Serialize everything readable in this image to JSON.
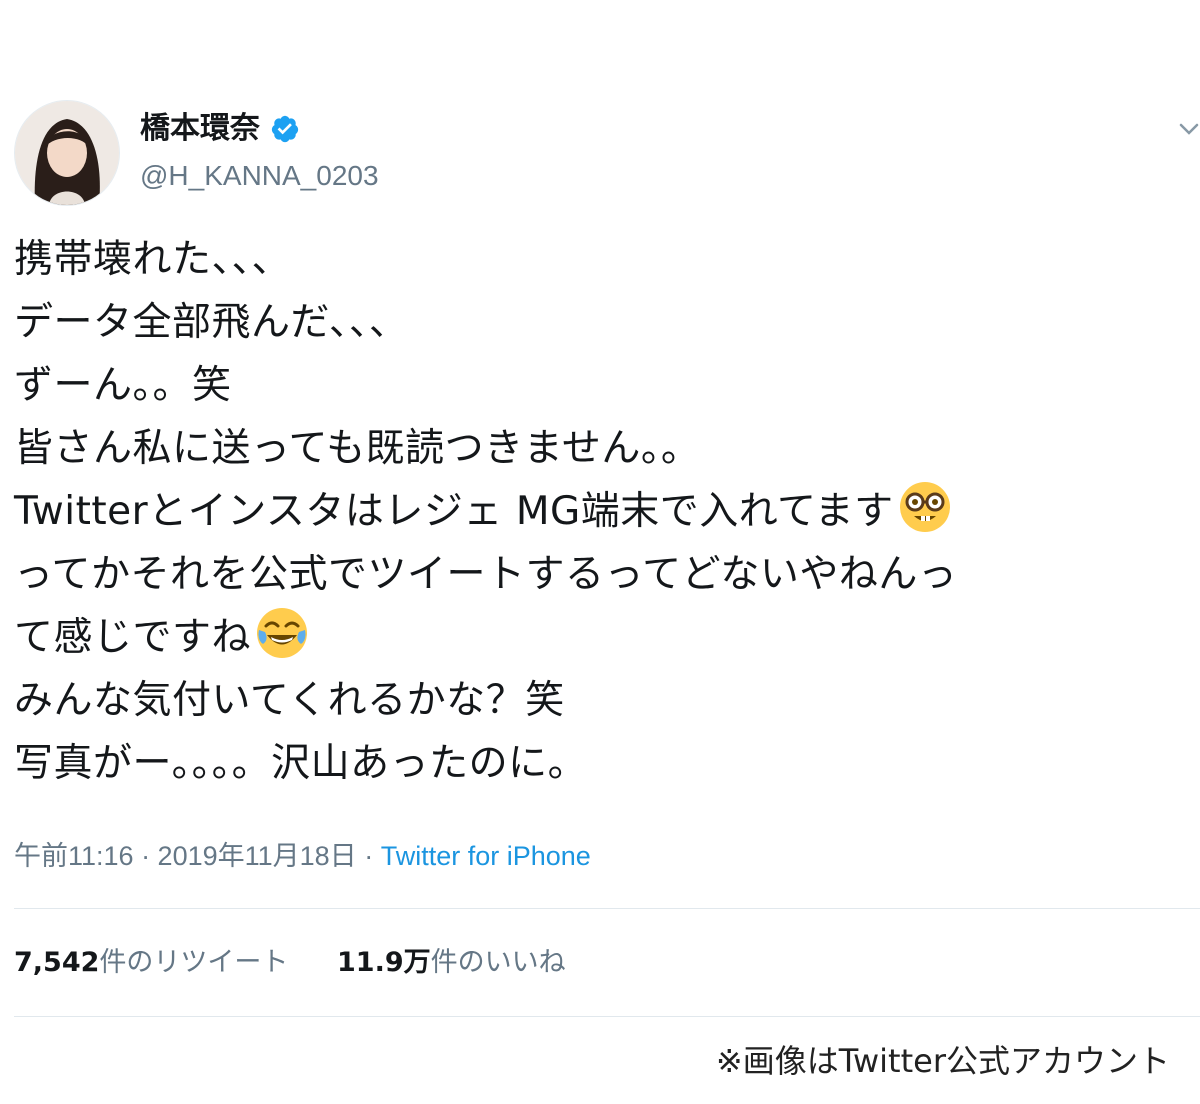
{
  "tweet": {
    "author": {
      "display_name": "橋本環奈",
      "username": "@H_KANNA_0203",
      "verified": true,
      "avatar_icon": "profile-photo"
    },
    "text_lines": [
      "携帯壊れた、、、",
      "データ全部飛んだ、、、",
      "ずーん。。笑",
      "皆さん私に送っても既読つきません。。",
      "Twitterとインスタはレジェ MG端末で入れてます",
      "ってかそれを公式でツイートするってどないやねんっ",
      "て感じですね",
      "みんな気付いてくれるかな？笑",
      "写真がー。。。。沢山あったのに。"
    ],
    "emojis": {
      "nerd": "nerd-face-emoji",
      "laugh": "tears-of-joy-emoji"
    },
    "timestamp": "午前11:16 · 2019年11月18日",
    "separator": " · ",
    "source": "Twitter for iPhone",
    "stats": {
      "retweets_count": "7,542",
      "retweets_label": "件のリツイート",
      "likes_count": "11.9万",
      "likes_label": "件のいいね"
    }
  },
  "caption": "※画像はTwitter公式アカウント",
  "colors": {
    "verified_blue": "#1da1f2",
    "link_blue": "#1b95e0",
    "secondary_text": "#657786"
  }
}
